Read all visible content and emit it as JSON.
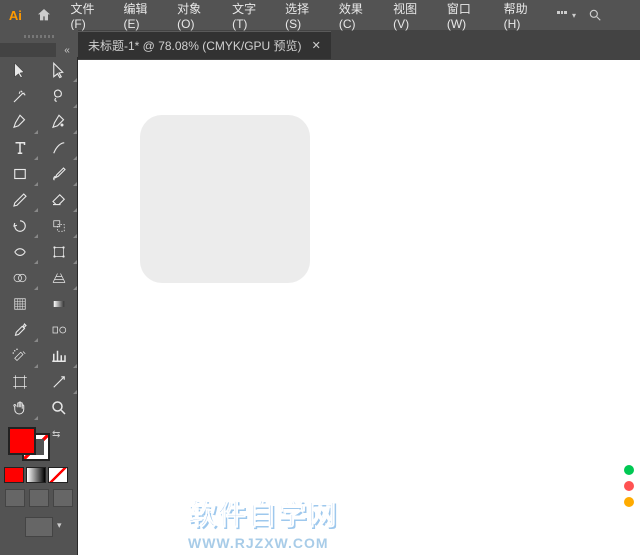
{
  "menubar": {
    "items": [
      "文件(F)",
      "编辑(E)",
      "对象(O)",
      "文字(T)",
      "选择(S)",
      "效果(C)",
      "视图(V)",
      "窗口(W)",
      "帮助(H)"
    ]
  },
  "tab": {
    "title": "未标题-1* @ 78.08%  (CMYK/GPU 预览)",
    "close": "✕"
  },
  "tools": [
    {
      "name": "selection-tool",
      "tri": false
    },
    {
      "name": "direct-selection-tool",
      "tri": true
    },
    {
      "name": "magic-wand-tool",
      "tri": false
    },
    {
      "name": "lasso-tool",
      "tri": true
    },
    {
      "name": "pen-tool",
      "tri": true
    },
    {
      "name": "curvature-tool",
      "tri": true
    },
    {
      "name": "type-tool",
      "tri": true
    },
    {
      "name": "line-segment-tool",
      "tri": true
    },
    {
      "name": "rectangle-tool",
      "tri": true
    },
    {
      "name": "paintbrush-tool",
      "tri": true
    },
    {
      "name": "pencil-tool",
      "tri": true
    },
    {
      "name": "eraser-tool",
      "tri": true
    },
    {
      "name": "rotate-tool",
      "tri": true
    },
    {
      "name": "scale-tool",
      "tri": true
    },
    {
      "name": "width-tool",
      "tri": true
    },
    {
      "name": "free-transform-tool",
      "tri": true
    },
    {
      "name": "shape-builder-tool",
      "tri": true
    },
    {
      "name": "perspective-grid-tool",
      "tri": true
    },
    {
      "name": "mesh-tool",
      "tri": false
    },
    {
      "name": "gradient-tool",
      "tri": false
    },
    {
      "name": "eyedropper-tool",
      "tri": true
    },
    {
      "name": "blend-tool",
      "tri": false
    },
    {
      "name": "symbol-sprayer-tool",
      "tri": true
    },
    {
      "name": "column-graph-tool",
      "tri": true
    },
    {
      "name": "artboard-tool",
      "tri": false
    },
    {
      "name": "slice-tool",
      "tri": true
    },
    {
      "name": "hand-tool",
      "tri": true
    },
    {
      "name": "zoom-tool",
      "tri": false
    }
  ],
  "colors": {
    "fill": "#ff0000",
    "stroke": "none"
  },
  "small_swatches": [
    "#ff0000",
    "#888888",
    "#000000"
  ],
  "watermark": {
    "title": "软件自学网",
    "url": "WWW.RJZXW.COM"
  },
  "right_dots": [
    "#00c853",
    "#ff5252",
    "#ffab00"
  ]
}
